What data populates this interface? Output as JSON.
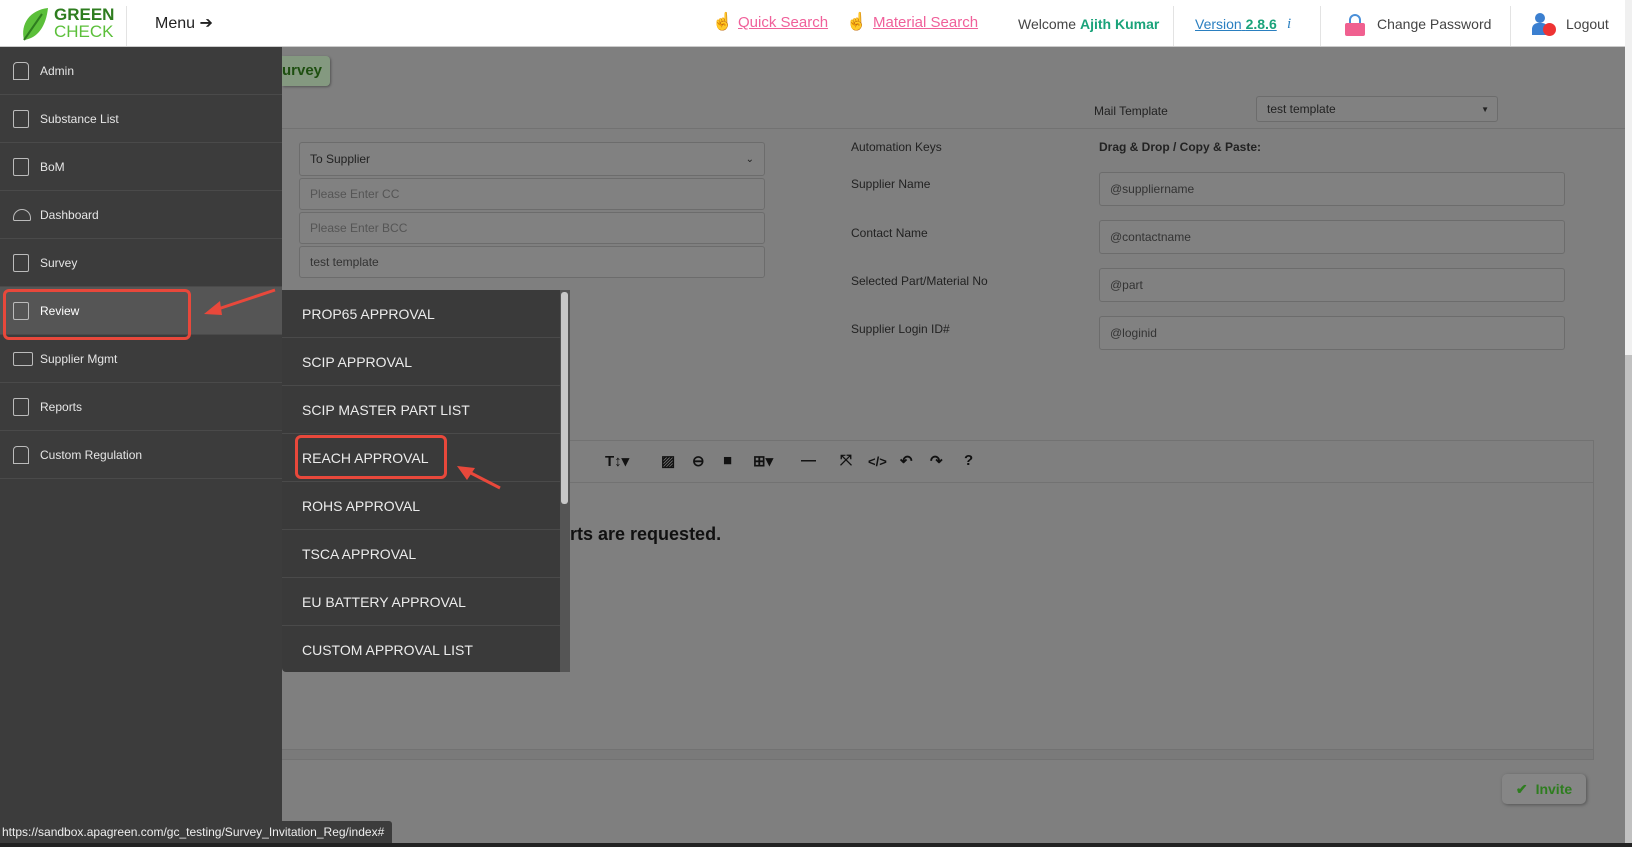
{
  "header": {
    "logo": [
      "GREEN",
      "CHECK"
    ],
    "menu_label": "Menu",
    "quick_search": "Quick Search",
    "material_search": "Material Search",
    "welcome": "Welcome",
    "user_name": "Ajith Kumar",
    "version_label": "Version",
    "version_number": "2.8.6",
    "change_password": "Change Password",
    "logout": "Logout"
  },
  "sidebar": {
    "items": [
      {
        "label": "Admin"
      },
      {
        "label": "Substance List"
      },
      {
        "label": "BoM"
      },
      {
        "label": "Dashboard"
      },
      {
        "label": "Survey"
      },
      {
        "label": "Review"
      },
      {
        "label": "Supplier Mgmt"
      },
      {
        "label": "Reports"
      },
      {
        "label": "Custom Regulation"
      }
    ]
  },
  "review_menu": {
    "items": [
      {
        "label": "PROP65 APPROVAL"
      },
      {
        "label": "SCIP APPROVAL"
      },
      {
        "label": "SCIP MASTER PART LIST"
      },
      {
        "label": "REACH APPROVAL"
      },
      {
        "label": "ROHS APPROVAL"
      },
      {
        "label": "TSCA APPROVAL"
      },
      {
        "label": "EU BATTERY APPROVAL"
      },
      {
        "label": "CUSTOM APPROVAL LIST"
      }
    ]
  },
  "main": {
    "tab_label": "urvey",
    "mail_template_label": "Mail Template",
    "mail_template_value": "test template",
    "recipient_select": "To Supplier",
    "cc_placeholder": "Please Enter CC",
    "bcc_placeholder": "Please Enter BCC",
    "template_name": "test template",
    "automation_keys_label": "Automation Keys",
    "drag_drop_label": "Drag & Drop / Copy & Paste:",
    "keys": [
      {
        "label": "Supplier Name",
        "value": "@suppliername"
      },
      {
        "label": "Contact Name",
        "value": "@contactname"
      },
      {
        "label": "Selected Part/Material No",
        "value": "@part"
      },
      {
        "label": "Supplier Login ID#",
        "value": "@loginid"
      }
    ],
    "editor_text": "rts are requested.",
    "invite_label": "Invite",
    "toolbar": [
      "T↕▾",
      "▨",
      "⊖",
      "■",
      "⊞▾",
      "—",
      "⤧",
      "</>",
      "↶",
      "↷",
      "?"
    ]
  },
  "status_url": "https://sandbox.apagreen.com/gc_testing/Survey_Invitation_Reg/index#",
  "colors": {
    "accent": "#e8483b",
    "link": "#f0609a",
    "green": "#2e7d1f"
  }
}
